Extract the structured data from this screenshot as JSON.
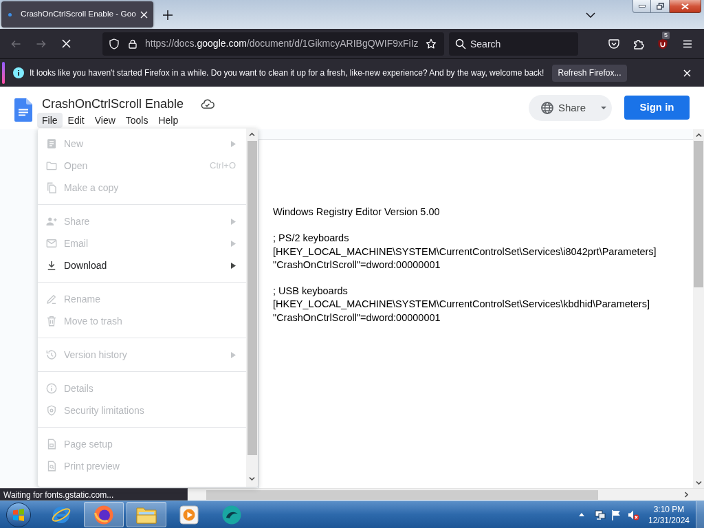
{
  "browser": {
    "tabs": [
      {
        "title": "CrashOnCtrlScroll Enable - Goo",
        "selected": true
      }
    ],
    "back": {
      "disabled": true
    },
    "forward": {
      "disabled": true
    },
    "url": {
      "start": "https://docs.",
      "host": "google.com",
      "rest": "/document/d/1GikmcyARIBgQWIF9xFiIz"
    },
    "search": {
      "placeholder": "Search"
    },
    "extension_badge": "5",
    "notification": {
      "message": "It looks like you haven't started Firefox in a while. Do you want to clean it up for a fresh, like-new experience? And by the way, welcome back!",
      "button": "Refresh Firefox..."
    },
    "status_text": "Waiting for fonts.gstatic.com..."
  },
  "docs": {
    "title": "CrashOnCtrlScroll Enable",
    "menus": [
      {
        "label": "File",
        "selected": true
      },
      {
        "label": "Edit",
        "selected": false
      },
      {
        "label": "View",
        "selected": false
      },
      {
        "label": "Tools",
        "selected": false
      },
      {
        "label": "Help",
        "selected": false
      }
    ],
    "share_button": "Share",
    "sign_in_button": "Sign in",
    "file_menu": {
      "groups": [
        {
          "items": [
            {
              "label": "New",
              "kind": "new",
              "disabled": true,
              "submenu": true
            },
            {
              "label": "Open",
              "kind": "open",
              "disabled": true,
              "submenu": false,
              "shortcut": "Ctrl+O"
            },
            {
              "label": "Make a copy",
              "kind": "copy",
              "disabled": true,
              "submenu": false
            }
          ]
        },
        {
          "items": [
            {
              "label": "Share",
              "kind": "share",
              "disabled": true,
              "submenu": true
            },
            {
              "label": "Email",
              "kind": "email",
              "disabled": true,
              "submenu": true
            },
            {
              "label": "Download",
              "kind": "download",
              "disabled": false,
              "submenu": true
            }
          ]
        },
        {
          "items": [
            {
              "label": "Rename",
              "kind": "rename",
              "disabled": true,
              "submenu": false
            },
            {
              "label": "Move to trash",
              "kind": "trash",
              "disabled": true,
              "submenu": false
            }
          ]
        },
        {
          "items": [
            {
              "label": "Version history",
              "kind": "history",
              "disabled": true,
              "submenu": true
            }
          ]
        },
        {
          "items": [
            {
              "label": "Details",
              "kind": "details",
              "disabled": true,
              "submenu": false
            },
            {
              "label": "Security limitations",
              "kind": "security",
              "disabled": true,
              "submenu": false
            }
          ]
        },
        {
          "items": [
            {
              "label": "Page setup",
              "kind": "page",
              "disabled": true,
              "submenu": false
            },
            {
              "label": "Print preview",
              "kind": "preview",
              "disabled": true,
              "submenu": false
            }
          ]
        }
      ]
    },
    "document": {
      "paragraphs": [
        {
          "lines": [
            "Windows Registry Editor Version 5.00"
          ]
        },
        {
          "lines": [
            "; PS/2 keyboards",
            "[HKEY_LOCAL_MACHINE\\SYSTEM\\CurrentControlSet\\Services\\i8042prt\\Parameters]",
            "\"CrashOnCtrlScroll\"=dword:00000001"
          ]
        },
        {
          "lines": [
            "; USB keyboards",
            "[HKEY_LOCAL_MACHINE\\SYSTEM\\CurrentControlSet\\Services\\kbdhid\\Parameters]",
            "\"CrashOnCtrlScroll\"=dword:00000001"
          ]
        }
      ]
    }
  },
  "taskbar": {
    "apps": [
      {
        "kind": "ie",
        "running": false
      },
      {
        "kind": "firefox",
        "running": true
      },
      {
        "kind": "explorer",
        "running": true
      },
      {
        "kind": "player",
        "running": false
      },
      {
        "kind": "app",
        "running": false
      }
    ],
    "volume": {
      "muted": true
    },
    "clock": {
      "time": "3:10 PM",
      "date": "12/31/2024"
    }
  }
}
